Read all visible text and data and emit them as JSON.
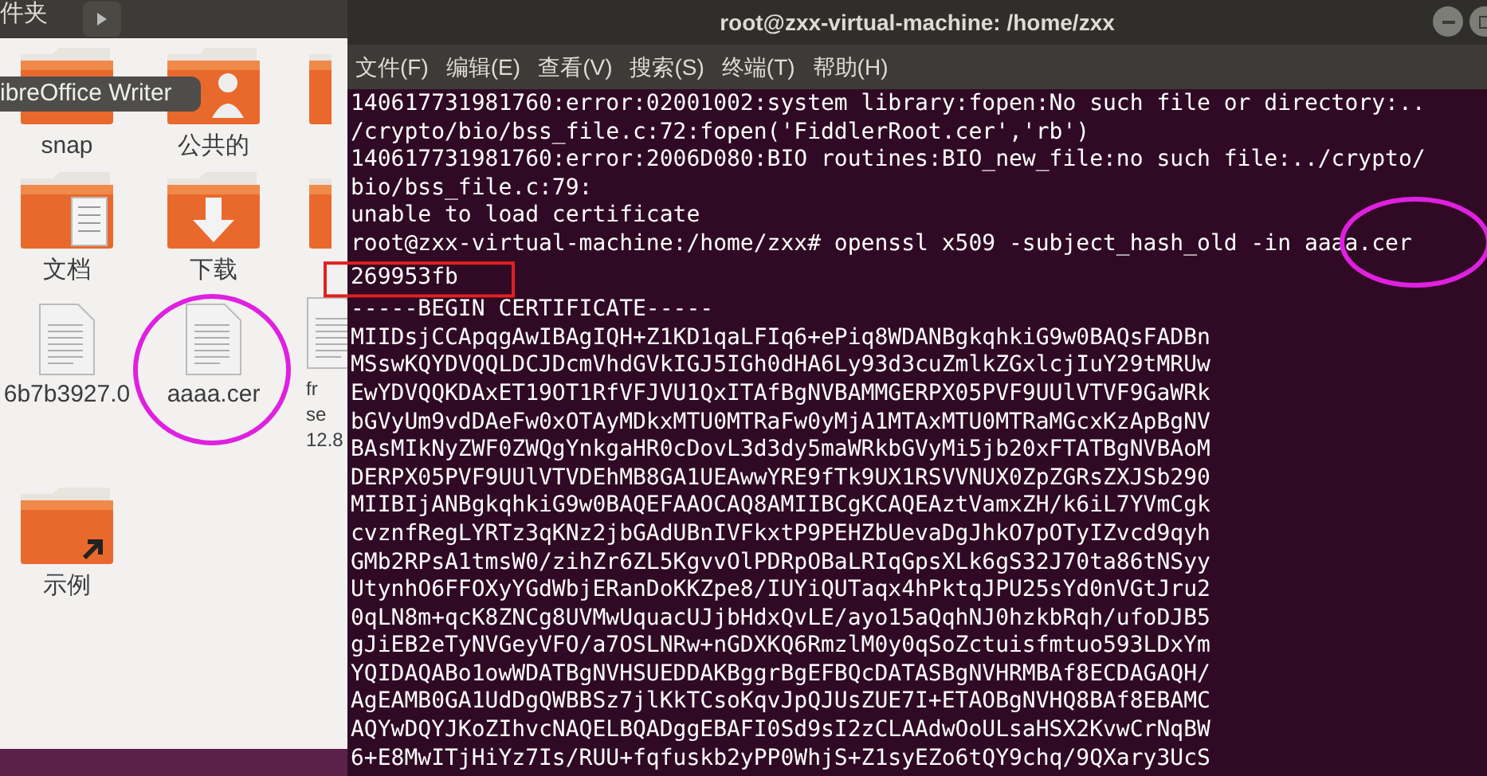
{
  "file_manager": {
    "header_title": "件夹",
    "tooltip": "ibreOffice Writer",
    "items": [
      {
        "kind": "folder",
        "label": "snap"
      },
      {
        "kind": "folder-user",
        "label": "公共的"
      },
      {
        "kind": "folder"
      },
      {
        "kind": "folder-document",
        "label": "文档"
      },
      {
        "kind": "folder-download",
        "label": "下载"
      },
      {
        "kind": "folder"
      },
      {
        "kind": "file",
        "label": "6b7b3927.0"
      },
      {
        "kind": "file",
        "label": "aaaa.cer"
      },
      {
        "kind": "file",
        "label": "fr\nse\n12.8"
      },
      {
        "kind": "folder-link",
        "label": "示例"
      }
    ]
  },
  "terminal": {
    "title": "root@zxx-virtual-machine: /home/zxx",
    "menu": [
      "文件(F)",
      "编辑(E)",
      "查看(V)",
      "搜索(S)",
      "终端(T)",
      "帮助(H)"
    ],
    "lines": [
      "140617731981760:error:02001002:system library:fopen:No such file or directory:..",
      "/crypto/bio/bss_file.c:72:fopen('FiddlerRoot.cer','rb')",
      "140617731981760:error:2006D080:BIO routines:BIO_new_file:no such file:../crypto/",
      "bio/bss_file.c:79:",
      "unable to load certificate",
      "root@zxx-virtual-machine:/home/zxx# openssl x509 -subject_hash_old -in aaaa.cer",
      "269953fb",
      "-----BEGIN CERTIFICATE-----",
      "MIIDsjCCApqgAwIBAgIQH+Z1KD1qaLFIq6+ePiq8WDANBgkqhkiG9w0BAQsFADBn",
      "MSswKQYDVQQLDCJDcmVhdGVkIGJ5IGh0dHA6Ly93d3cuZmlkZGxlcjIuY29tMRUw",
      "EwYDVQQKDAxET19OT1RfVFJVU1QxITAfBgNVBAMMGERPX05PVF9UUlVTVF9GaWRk",
      "bGVyUm9vdDAeFw0xOTAyMDkxMTU0MTRaFw0yMjA1MTAxMTU0MTRaMGcxKzApBgNV",
      "BAsMIkNyZWF0ZWQgYnkgaHR0cDovL3d3dy5maWRkbGVyMi5jb20xFTATBgNVBAoM",
      "DERPX05PVF9UUlVTVDEhMB8GA1UEAwwYRE9fTk9UX1RSVVNUX0ZpZGRsZXJSb290",
      "MIIBIjANBgkqhkiG9w0BAQEFAAOCAQ8AMIIBCgKCAQEAztVamxZH/k6iL7YVmCgk",
      "cvznfRegLYRTz3qKNz2jbGAdUBnIVFkxtP9PEHZbUevaDgJhkO7pOTyIZvcd9qyh",
      "GMb2RPsA1tmsW0/zihZr6ZL5KgvvOlPDRpOBaLRIqGpsXLk6gS32J70ta86tNSyy",
      "UtynhO6FFOXyYGdWbjERanDoKKZpe8/IUYiQUTaqx4hPktqJPU25sYd0nVGtJru2",
      "0qLN8m+qcK8ZNCg8UVMwUquacUJjbHdxQvLE/ayo15aQqhNJ0hzkbRqh/ufoDJB5",
      "gJiEB2eTyNVGeyVFO/a7OSLNRw+nGDXKQ6RmzlM0y0qSoZctuisfmtuo593LDxYm",
      "YQIDAQABo1owWDATBgNVHSUEDDAKBggrBgEFBQcDATASBgNVHRMBAf8ECDAGAQH/",
      "AgEAMB0GA1UdDgQWBBSz7jlKkTCsoKqvJpQJUsZUE7I+ETAOBgNVHQ8BAf8EBAMC",
      "AQYwDQYJKoZIhvcNAQELBQADggEBAFI0Sd9sI2zCLAAdwOoULsaHSX2KvwCrNqBW",
      "6+E8MwITjHiYz7Is/RUU+fqfuskb2yPP0WhjS+Z1syEZo6tQY9chq/9QXary3UcS"
    ]
  }
}
